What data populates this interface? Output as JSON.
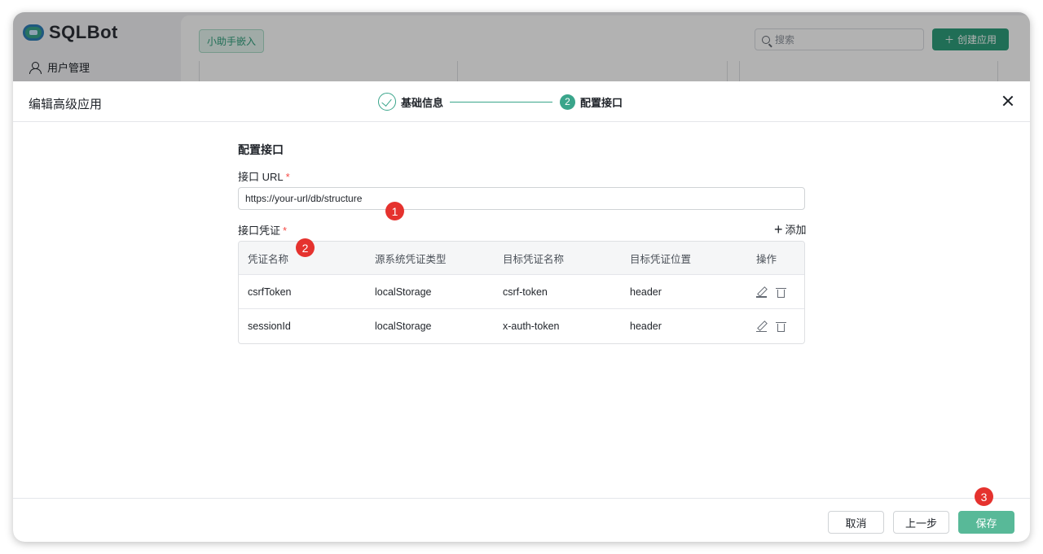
{
  "background": {
    "logo_text": "SQLBot",
    "sidebar_item": "用户管理",
    "tag_label": "小助手嵌入",
    "search_placeholder": "搜索",
    "create_button": "创建应用"
  },
  "dialog": {
    "title": "编辑高级应用",
    "steps": [
      {
        "label": "基础信息",
        "status": "done"
      },
      {
        "number": "2",
        "label": "配置接口",
        "status": "active"
      }
    ],
    "section_title": "配置接口",
    "url_label": "接口 URL",
    "url_value": "https://your-url/db/structure",
    "credential_label": "接口凭证",
    "add_label": "添加",
    "table": {
      "headers": [
        "凭证名称",
        "源系统凭证类型",
        "目标凭证名称",
        "目标凭证位置",
        "操作"
      ],
      "rows": [
        [
          "csrfToken",
          "localStorage",
          "csrf-token",
          "header"
        ],
        [
          "sessionId",
          "localStorage",
          "x-auth-token",
          "header"
        ]
      ]
    },
    "footer": {
      "cancel": "取消",
      "prev": "上一步",
      "save": "保存"
    }
  },
  "annotations": [
    "1",
    "2",
    "3"
  ],
  "colors": {
    "accent": "#3aa58b",
    "primary_button": "#58b998",
    "badge": "#e5322e"
  }
}
